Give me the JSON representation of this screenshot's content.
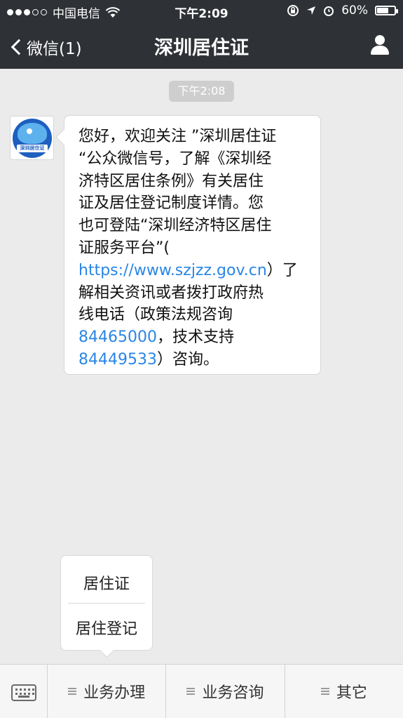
{
  "status_bar": {
    "carrier": "中国电信",
    "time": "下午2:09",
    "battery": "60%"
  },
  "nav": {
    "back_label": "微信(1)",
    "title": "深圳居住证"
  },
  "chat": {
    "timestamp": "下午2:08",
    "avatar_text": "深圳居住证",
    "message_lines": [
      "您好，欢迎关注 ”深圳居住证",
      "“公众微信号，了解《深圳经",
      "济特区居住条例》有关居住",
      "证及居住登记制度详情。您",
      "也可登陆“深圳经济特区居住",
      "证服务平台”(",
      "https://www.szjzz.gov.cn",
      "）了",
      "解相关资讯或者拨打政府热",
      "线电话（政策法规咨询",
      "84465000",
      "，技术支持",
      "84449533",
      "）咨询。"
    ]
  },
  "popup_menu": {
    "items": [
      "居住证",
      "居住登记"
    ]
  },
  "menu_bar": {
    "tabs": [
      "业务办理",
      "业务咨询",
      "其它"
    ]
  }
}
